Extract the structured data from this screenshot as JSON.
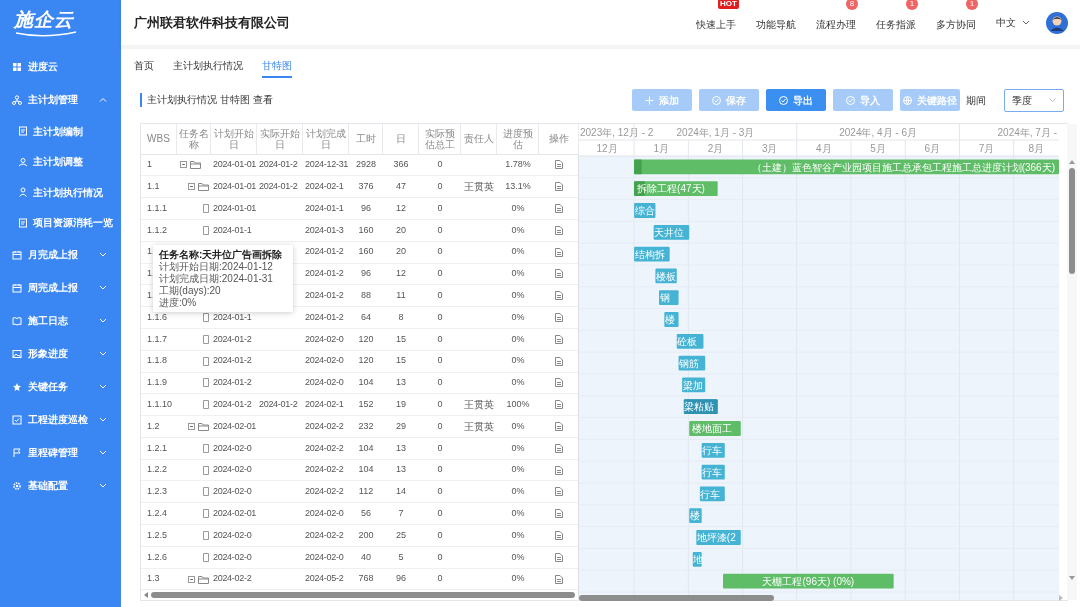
{
  "sidebar": {
    "logo": "施企云",
    "items": [
      {
        "label": "进度云"
      },
      {
        "label": "主计划管理",
        "expanded": true,
        "children": [
          {
            "label": "主计划编制"
          },
          {
            "label": "主计划调整"
          },
          {
            "label": "主计划执行情况"
          },
          {
            "label": "项目资源消耗一览"
          }
        ]
      },
      {
        "label": "月完成上报",
        "expanded": false
      },
      {
        "label": "周完成上报",
        "expanded": false
      },
      {
        "label": "施工日志",
        "expanded": false
      },
      {
        "label": "形象进度",
        "expanded": false
      },
      {
        "label": "关键任务",
        "expanded": false
      },
      {
        "label": "工程进度巡检",
        "expanded": false
      },
      {
        "label": "里程碑管理",
        "expanded": false
      },
      {
        "label": "基础配置",
        "expanded": false
      }
    ]
  },
  "header": {
    "company": "广州联君软件科技有限公司",
    "nav": [
      {
        "label": "快速上手",
        "badge": "HOT",
        "kind": "hot"
      },
      {
        "label": "功能导航"
      },
      {
        "label": "流程办理",
        "badge": "8",
        "kind": "count"
      },
      {
        "label": "任务指派",
        "badge": "1",
        "kind": "count"
      },
      {
        "label": "多方协同",
        "badge": "1",
        "kind": "count"
      }
    ],
    "language": "中文"
  },
  "tabs": [
    {
      "label": "首页",
      "selected": false
    },
    {
      "label": "主计划执行情况",
      "selected": false
    },
    {
      "label": "甘特图",
      "selected": true
    }
  ],
  "section_title": "主计划执行情况 甘特图 查看",
  "toolbar": {
    "buttons": [
      {
        "label": "添加",
        "kind": "add",
        "disabled": true
      },
      {
        "label": "保存",
        "kind": "check",
        "disabled": true
      },
      {
        "label": "导出",
        "kind": "check",
        "disabled": false
      },
      {
        "label": "导入",
        "kind": "check",
        "disabled": true
      },
      {
        "label": "关键路径",
        "kind": "globe",
        "disabled": true
      }
    ],
    "period_label": "期间",
    "period_value": "季度"
  },
  "table": {
    "columns": [
      "WBS",
      "任务名称",
      "计划开始日",
      "实际开始日",
      "计划完成日",
      "工时",
      "日",
      "实际预估总工",
      "责任人",
      "进度预估",
      "操作"
    ],
    "rows": [
      {
        "wbs": "1",
        "kind": "group",
        "plan_start": "2024-01-01",
        "actual_start": "2024-01-2",
        "plan_end": "2024-12-31",
        "hours": "2928",
        "days": "366",
        "estimate": "0",
        "progress": "1.78%",
        "level": 0.0178,
        "bar_label": "（土建）蓝色智谷产业园项目施工总承包工程施工总进度计划(366天)",
        "children": [
          {
            "wbs": "1.1",
            "kind": "group",
            "plan_start": "2024-01-01",
            "actual_start": "2024-01-2",
            "plan_end": "2024-02-1",
            "hours": "376",
            "days": "47",
            "estimate": "0",
            "owner": "王贯英",
            "progress": "13.1%",
            "level": 0.131,
            "bar_label": "拆除工程(47天)",
            "children": [
              {
                "wbs": "1.1.1",
                "kind": "task",
                "plan_start": "2024-01-01",
                "plan_end": "2024-01-1",
                "hours": "96",
                "days": "12",
                "estimate": "0",
                "progress": "0%",
                "bar_label": "综合"
              },
              {
                "wbs": "1.1.2",
                "kind": "task",
                "plan_start": "2024-01-1",
                "plan_end": "2024-01-3",
                "hours": "160",
                "days": "20",
                "estimate": "0",
                "progress": "0%",
                "bar_label": "天井位"
              },
              {
                "wbs": "1.",
                "kind": "task",
                "plan_end": "2024-01-2",
                "hours": "160",
                "days": "20",
                "estimate": "0",
                "progress": "0%",
                "bar_label": "结构拆"
              },
              {
                "wbs": "1.",
                "kind": "task",
                "plan_end": "2024-01-2",
                "hours": "96",
                "days": "12",
                "estimate": "0",
                "progress": "0%",
                "bar_label": "楼板"
              },
              {
                "wbs": "1.",
                "kind": "task",
                "plan_end": "2024-01-2",
                "hours": "88",
                "days": "11",
                "estimate": "0",
                "progress": "0%",
                "bar_label": "钢"
              },
              {
                "wbs": "1.1.6",
                "kind": "task",
                "plan_start": "2024-01-1",
                "plan_end": "2024-01-2",
                "hours": "64",
                "days": "8",
                "estimate": "0",
                "progress": "0%",
                "bar_label": "楼"
              },
              {
                "wbs": "1.1.7",
                "kind": "task",
                "plan_start": "2024-01-2",
                "plan_end": "2024-02-0",
                "hours": "120",
                "days": "15",
                "estimate": "0",
                "progress": "0%",
                "bar_label": "砼板"
              },
              {
                "wbs": "1.1.8",
                "kind": "task",
                "plan_start": "2024-01-2",
                "plan_end": "2024-02-0",
                "hours": "120",
                "days": "15",
                "estimate": "0",
                "progress": "0%",
                "bar_label": "钢筋"
              },
              {
                "wbs": "1.1.9",
                "kind": "task",
                "plan_start": "2024-01-2",
                "plan_end": "2024-02-0",
                "hours": "104",
                "days": "13",
                "estimate": "0",
                "progress": "0%",
                "bar_label": "梁加"
              },
              {
                "wbs": "1.1.10",
                "kind": "task",
                "plan_start": "2024-01-2",
                "actual_start": "2024-01-2",
                "plan_end": "2024-02-1",
                "hours": "152",
                "days": "19",
                "estimate": "0",
                "owner": "王贯英",
                "progress": "100%",
                "level": 1,
                "bar_label": "梁粘贴"
              }
            ]
          },
          {
            "wbs": "1.2",
            "kind": "group",
            "plan_start": "2024-02-01",
            "plan_end": "2024-02-2",
            "hours": "232",
            "days": "29",
            "estimate": "0",
            "owner": "王贯英",
            "progress": "0%",
            "bar_label": "楼地面工",
            "children": [
              {
                "wbs": "1.2.1",
                "kind": "task",
                "plan_start": "2024-02-0",
                "plan_end": "2024-02-2",
                "hours": "104",
                "days": "13",
                "estimate": "0",
                "progress": "0%",
                "bar_label": "行车"
              },
              {
                "wbs": "1.2.2",
                "kind": "task",
                "plan_start": "2024-02-0",
                "plan_end": "2024-02-2",
                "hours": "104",
                "days": "13",
                "estimate": "0",
                "progress": "0%",
                "bar_label": "行车"
              },
              {
                "wbs": "1.2.3",
                "kind": "task",
                "plan_start": "2024-02-0",
                "plan_end": "2024-02-2",
                "hours": "112",
                "days": "14",
                "estimate": "0",
                "progress": "0%",
                "bar_label": "行车"
              },
              {
                "wbs": "1.2.4",
                "kind": "task",
                "plan_start": "2024-02-01",
                "plan_end": "2024-02-0",
                "hours": "56",
                "days": "7",
                "estimate": "0",
                "progress": "0%",
                "bar_label": "楼"
              },
              {
                "wbs": "1.2.5",
                "kind": "task",
                "plan_start": "2024-02-0",
                "plan_end": "2024-02-2",
                "hours": "200",
                "days": "25",
                "estimate": "0",
                "progress": "0%",
                "bar_label": "地坪漆(2"
              },
              {
                "wbs": "1.2.6",
                "kind": "task",
                "plan_start": "2024-02-0",
                "plan_end": "2024-02-0",
                "hours": "40",
                "days": "5",
                "estimate": "0",
                "progress": "0%",
                "bar_label": "地"
              }
            ]
          },
          {
            "wbs": "1.3",
            "kind": "group",
            "plan_start": "2024-02-2",
            "plan_end": "2024-05-2",
            "hours": "768",
            "days": "96",
            "estimate": "0",
            "progress": "0%",
            "bar_label": "天棚工程(96天) (0%)"
          }
        ]
      }
    ]
  },
  "tooltip": {
    "title": "任务名称:天井位广告画拆除",
    "lines": [
      "计划开始日期:2024-01-12",
      "计划完成日期:2024-01-31",
      "工期(days):20",
      "进度:0%"
    ]
  },
  "gantt": {
    "periods": [
      "2023年, 12月 - 2",
      "2024年, 1月 - 3月",
      "2024年, 4月 - 6月",
      "2024年, 7月 -"
    ],
    "months": [
      "12月",
      "1月",
      "2月",
      "3月",
      "4月",
      "5月",
      "6月",
      "7月",
      "8月"
    ]
  }
}
